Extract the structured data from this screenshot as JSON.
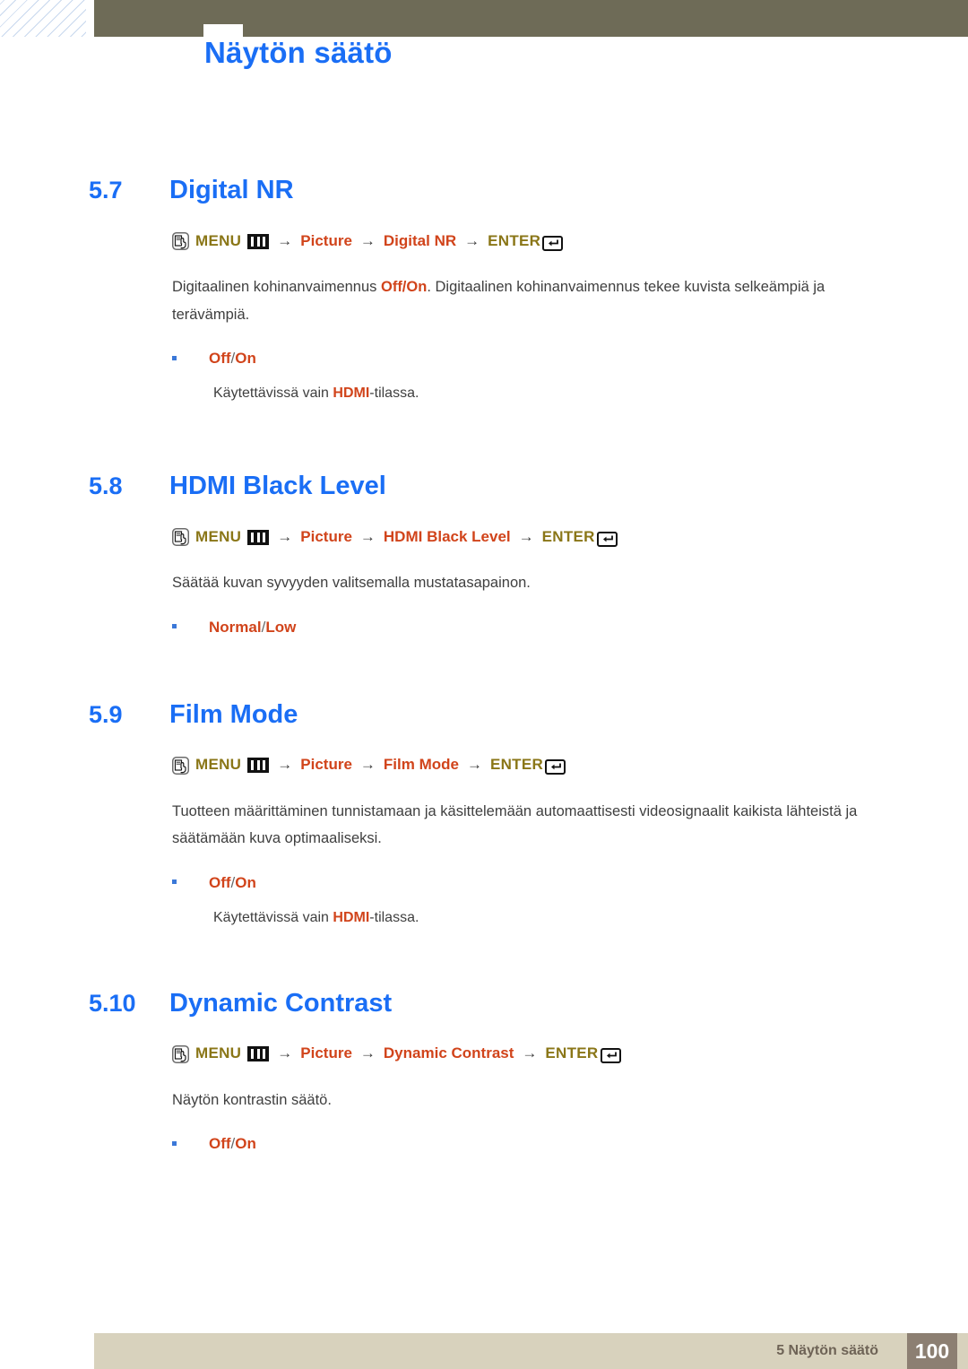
{
  "header": {
    "title": "Näytön säätö",
    "bar_color": "#6e6b57",
    "title_color": "#1a6ef5"
  },
  "icons": {
    "hand": "hand-press-icon",
    "menu_bars": "menu-bars-icon",
    "enter_key": "enter-key-icon",
    "arrow": "→"
  },
  "colors": {
    "heading_blue": "#1a6ef5",
    "menu_olive": "#8a7617",
    "item_orange": "#d1441b",
    "body_gray": "#3f3f3f",
    "bullet_blue": "#3b78d8",
    "footer_bg": "#d8d2bd",
    "footer_page_bg": "#8c7f72"
  },
  "sections": [
    {
      "number": "5.7",
      "title": "Digital NR",
      "menupath": {
        "menu_label": "MENU",
        "items": [
          "Picture",
          "Digital NR"
        ],
        "enter_label": "ENTER"
      },
      "paragraph_pre": "Digitaalinen kohinanvaimennus ",
      "paragraph_hl": "Off/On",
      "paragraph_post": ". Digitaalinen kohinanvaimennus tekee kuvista selkeämpiä ja terävämpiä.",
      "bullet": {
        "first": "Off",
        "sep": " / ",
        "second": "On"
      },
      "subnote_pre": "Käytettävissä vain ",
      "subnote_hl": "HDMI",
      "subnote_post": "-tilassa."
    },
    {
      "number": "5.8",
      "title": "HDMI Black Level",
      "menupath": {
        "menu_label": "MENU",
        "items": [
          "Picture",
          "HDMI Black Level"
        ],
        "enter_label": "ENTER"
      },
      "paragraph_pre": "Säätää kuvan syvyyden valitsemalla mustatasapainon.",
      "paragraph_hl": "",
      "paragraph_post": "",
      "bullet": {
        "first": "Normal",
        "sep": " / ",
        "second": "Low"
      },
      "subnote_pre": "",
      "subnote_hl": "",
      "subnote_post": ""
    },
    {
      "number": "5.9",
      "title": "Film Mode",
      "menupath": {
        "menu_label": "MENU",
        "items": [
          "Picture",
          "Film Mode"
        ],
        "enter_label": "ENTER"
      },
      "paragraph_pre": "Tuotteen määrittäminen tunnistamaan ja käsittelemään automaattisesti videosignaalit kaikista lähteistä ja säätämään kuva optimaaliseksi.",
      "paragraph_hl": "",
      "paragraph_post": "",
      "bullet": {
        "first": "Off",
        "sep": " / ",
        "second": "On"
      },
      "subnote_pre": "Käytettävissä vain ",
      "subnote_hl": "HDMI",
      "subnote_post": "-tilassa."
    },
    {
      "number": "5.10",
      "title": "Dynamic Contrast",
      "menupath": {
        "menu_label": "MENU",
        "items": [
          "Picture",
          "Dynamic Contrast"
        ],
        "enter_label": "ENTER"
      },
      "paragraph_pre": "Näytön kontrastin säätö.",
      "paragraph_hl": "",
      "paragraph_post": "",
      "bullet": {
        "first": "Off",
        "sep": " / ",
        "second": "On"
      },
      "subnote_pre": "",
      "subnote_hl": "",
      "subnote_post": ""
    }
  ],
  "footer": {
    "chapter_label": "5 Näytön säätö",
    "page_number": "100"
  }
}
